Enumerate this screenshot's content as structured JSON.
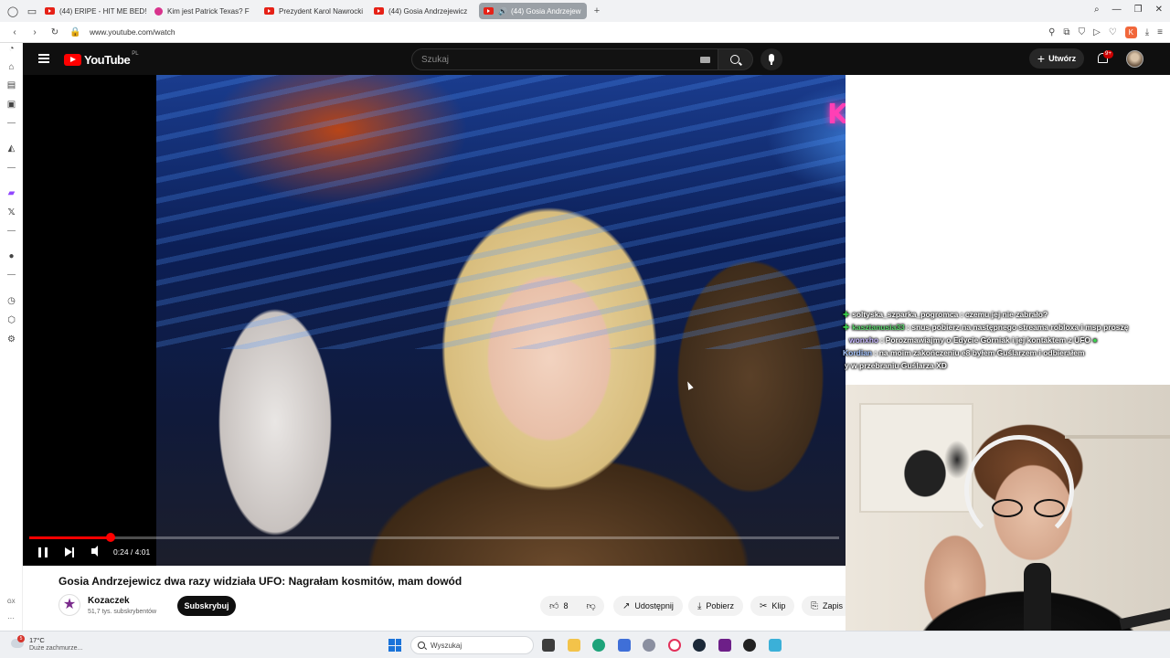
{
  "browser": {
    "tabs": [
      {
        "label": "(44) ERIPE - HIT ME BED!",
        "favicon": "youtube-icon"
      },
      {
        "label": "Kim jest Patrick Texas? F",
        "favicon": "pink-circle-icon"
      },
      {
        "label": "Prezydent Karol Nawrocki",
        "favicon": "youtube-icon"
      },
      {
        "label": "(44) Gosia Andrzejewicz",
        "favicon": "youtube-icon"
      },
      {
        "label": "(44) Gosia Andrzejew",
        "favicon": "youtube-icon",
        "active": true
      }
    ],
    "url": "www.youtube.com/watch",
    "profile_initial": "K"
  },
  "youtube": {
    "logo_text": "YouTube",
    "country_code": "PL",
    "search_placeholder": "Szukaj",
    "create_label": "Utwórz",
    "notifications_badge": "9+"
  },
  "video": {
    "overlay_brand": "KOZACZEK",
    "time": "0:24 / 4:01",
    "progress_fraction": 0.1,
    "title": "Gosia Andrzejewicz dwa razy widziała UFO: Nagrałam kosmitów, mam dowód",
    "channel_name": "Kozaczek",
    "subscribers": "51,7 tys. subskrybentów",
    "subscribe_label": "Subskrybuj",
    "like_count": "8",
    "share_label": "Udostępnij",
    "download_label": "Pobierz",
    "clip_label": "Klip",
    "save_label": "Zapis"
  },
  "chat": [
    {
      "user": "soltyska_szparka_pogromca",
      "text": "czemu jej nie zabrało?",
      "badge": true
    },
    {
      "user": "kasztanusia33",
      "text": "snus pobierz na następnego streama robloxa i msp proszę",
      "badge": true
    },
    {
      "user": "wonxho",
      "text": "Porozmawiajmy o Edycie Górniak i jej kontaktem z UFO",
      "badge": false
    },
    {
      "user": "Kordian",
      "text": "na moim zakończeniu e8 byłem Guślarzem i odbierałem",
      "badge": false
    },
    {
      "user": "",
      "text": "y w przebraniu Guślarza XD",
      "badge": false
    }
  ],
  "taskbar": {
    "temperature": "17°C",
    "weather": "Duże zachmurze...",
    "weather_badge": "5",
    "search_label": "Wyszukaj"
  },
  "left_sidebar": {
    "bottom_label": "GX"
  }
}
